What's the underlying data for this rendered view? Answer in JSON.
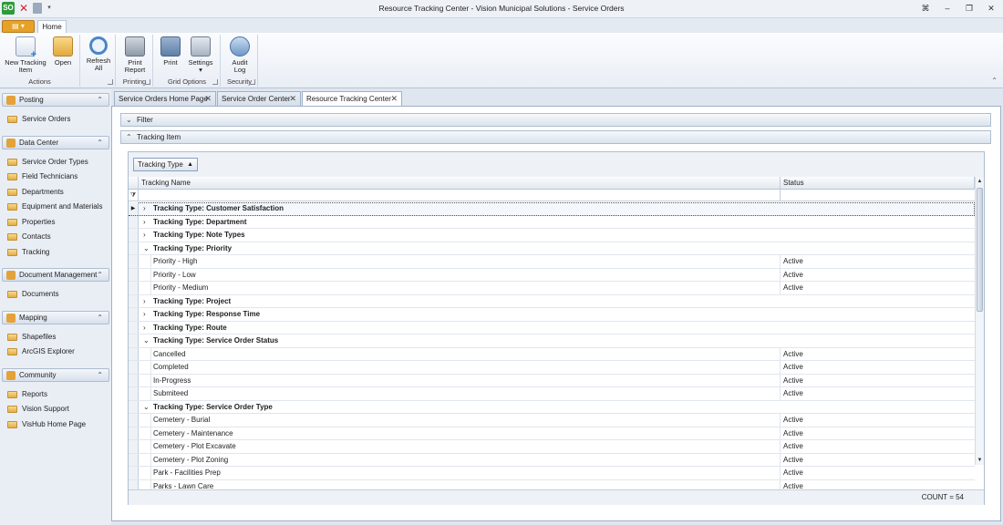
{
  "window": {
    "title": "Resource Tracking Center -  Vision Municipal Solutions - Service Orders",
    "qat_logo": "SO"
  },
  "ribbon": {
    "app_button": "▤ ▾",
    "home_tab": "Home",
    "groups": {
      "actions": "Actions",
      "printing": "Printing",
      "grid_options": "Grid Options",
      "security": "Security"
    },
    "buttons": {
      "new_tracking_item_1": "New Tracking",
      "new_tracking_item_2": "Item",
      "open": "Open",
      "refresh_1": "Refresh",
      "refresh_2": "All",
      "print_report_1": "Print",
      "print_report_2": "Report",
      "grid_print": "Print",
      "settings": "Settings",
      "settings_dd": "▾",
      "audit_log_1": "Audit",
      "audit_log_2": "Log"
    },
    "icons": {
      "new": "new-item-icon",
      "open": "folder-open-icon",
      "refresh": "refresh-icon",
      "print_report": "printer-icon",
      "grid_print": "grid-print-icon",
      "settings": "settings-icon",
      "audit": "audit-log-icon"
    }
  },
  "nav": {
    "sections": [
      {
        "title": "Posting",
        "items": [
          "Service Orders"
        ]
      },
      {
        "title": "Data Center",
        "items": [
          "Service Order Types",
          "Field Technicians",
          "Departments",
          "Equipment and Materials",
          "Properties",
          "Contacts",
          "Tracking"
        ]
      },
      {
        "title": "Document Management",
        "items": [
          "Documents"
        ]
      },
      {
        "title": "Mapping",
        "items": [
          "Shapefiles",
          "ArcGIS Explorer"
        ]
      },
      {
        "title": "Community",
        "items": [
          "Reports",
          "Vision Support",
          "VisHub Home Page"
        ]
      }
    ]
  },
  "tabs": [
    "Service Orders Home Page",
    "Service Order Center",
    "Resource Tracking Center"
  ],
  "active_tab": 2,
  "panel": {
    "filter_label": "Filter",
    "tracking_item_label": "Tracking Item",
    "group_by_chip": "Tracking Type",
    "columns": {
      "name": "Tracking Name",
      "status": "Status"
    },
    "rows": [
      {
        "type": "group",
        "text": "Tracking Type: Customer Satisfaction",
        "expanded": false,
        "focused": true
      },
      {
        "type": "group",
        "text": "Tracking Type: Department",
        "expanded": false
      },
      {
        "type": "group",
        "text": "Tracking Type: Note Types",
        "expanded": false
      },
      {
        "type": "group",
        "text": "Tracking Type: Priority",
        "expanded": true
      },
      {
        "type": "data",
        "name": "Priority - High",
        "status": "Active"
      },
      {
        "type": "data",
        "name": "Priority - Low",
        "status": "Active"
      },
      {
        "type": "data",
        "name": "Priority - Medium",
        "status": "Active"
      },
      {
        "type": "group",
        "text": "Tracking Type: Project",
        "expanded": false
      },
      {
        "type": "group",
        "text": "Tracking Type: Response Time",
        "expanded": false
      },
      {
        "type": "group",
        "text": "Tracking Type: Route",
        "expanded": false
      },
      {
        "type": "group",
        "text": "Tracking Type: Service Order Status",
        "expanded": true
      },
      {
        "type": "data",
        "name": "Cancelled",
        "status": "Active"
      },
      {
        "type": "data",
        "name": "Completed",
        "status": "Active"
      },
      {
        "type": "data",
        "name": "In-Progress",
        "status": "Active"
      },
      {
        "type": "data",
        "name": "Submiteed",
        "status": "Active"
      },
      {
        "type": "group",
        "text": "Tracking Type: Service Order Type",
        "expanded": true
      },
      {
        "type": "data",
        "name": "Cemetery - Burial",
        "status": "Active"
      },
      {
        "type": "data",
        "name": "Cemetery - Maintenance",
        "status": "Active"
      },
      {
        "type": "data",
        "name": "Cemetery - Plot Excavate",
        "status": "Active"
      },
      {
        "type": "data",
        "name": "Cemetery - Plot Zoning",
        "status": "Active"
      },
      {
        "type": "data",
        "name": "Park - Facilities Prep",
        "status": "Active"
      },
      {
        "type": "data",
        "name": "Parks - Lawn Care",
        "status": "Active"
      }
    ],
    "count_text": "COUNT = 54"
  },
  "colors": {
    "accent": "#e5a227",
    "panel_border": "#9fb0c6"
  }
}
